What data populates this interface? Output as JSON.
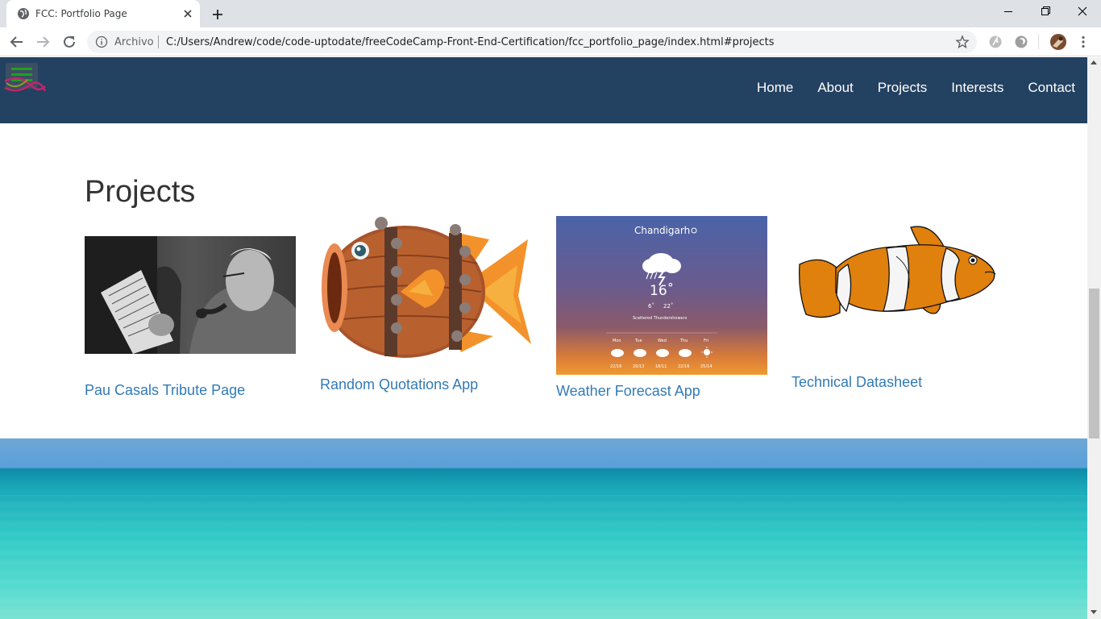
{
  "browser": {
    "tab_title": "FCC: Portfolio Page",
    "url_scheme": "Archivo",
    "url": "C:/Users/Andrew/code/code-uptodate/freeCodeCamp-Front-End-Certification/fcc_portfolio_page/index.html#projects"
  },
  "nav": {
    "links": [
      "Home",
      "About",
      "Projects",
      "Interests",
      "Contact"
    ]
  },
  "projects": {
    "heading": "Projects",
    "items": [
      {
        "title": "Pau Casals Tribute Page",
        "image": "black-and-white photo of a man with a pipe reading music"
      },
      {
        "title": "Random Quotations App",
        "image": "cartoon barrel fish"
      },
      {
        "title": "Weather Forecast App",
        "image": "weather app screenshot"
      },
      {
        "title": "Technical Datasheet",
        "image": "clownfish illustration"
      }
    ],
    "weather": {
      "city": "Chandigarh",
      "temp": "16˚",
      "low": "6˚",
      "high": "22˚",
      "condition": "Scattered Thundershowers",
      "days": [
        "Mon",
        "Tue",
        "Wed",
        "Thu",
        "Fri"
      ],
      "ranges": [
        "22/16",
        "20/13",
        "18/11",
        "22/16",
        "25/14"
      ]
    }
  },
  "colors": {
    "navbar": "#234160",
    "link": "#337ab7"
  }
}
